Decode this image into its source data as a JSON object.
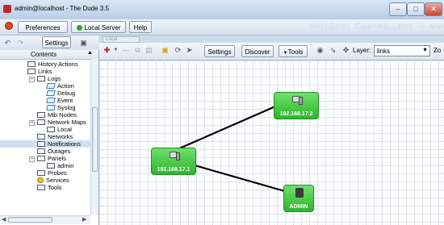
{
  "window": {
    "title": "admin@localhost - The Dude 3.5"
  },
  "toolbar": {
    "preferences": "Preferences",
    "server": "Local Server",
    "help": "Help",
    "brand": "HotSpot Controllers -> www"
  },
  "sidebar_toolbar": {
    "settings": "Settings"
  },
  "sidebar": {
    "header": "Contents",
    "items": [
      {
        "label": "History Actions",
        "icon": "folder-icon"
      },
      {
        "label": "Links",
        "icon": "folder-icon"
      },
      {
        "label": "Logs",
        "icon": "folder-icon"
      },
      {
        "label": "Action",
        "icon": "log-icon"
      },
      {
        "label": "Debug",
        "icon": "log-icon"
      },
      {
        "label": "Event",
        "icon": "log-icon"
      },
      {
        "label": "Syslog",
        "icon": "log-icon"
      },
      {
        "label": "Mib Nodes",
        "icon": "folder-icon"
      },
      {
        "label": "Network Maps",
        "icon": "folder-icon"
      },
      {
        "label": "Local",
        "icon": "map-icon"
      },
      {
        "label": "Networks",
        "icon": "folder-icon"
      },
      {
        "label": "Notifications",
        "icon": "folder-icon"
      },
      {
        "label": "Outages",
        "icon": "folder-icon"
      },
      {
        "label": "Panels",
        "icon": "folder-icon"
      },
      {
        "label": "admin",
        "icon": "panel-icon"
      },
      {
        "label": "Probes",
        "icon": "folder-icon"
      },
      {
        "label": "Services",
        "icon": "service-icon"
      },
      {
        "label": "Tools",
        "icon": "folder-icon"
      }
    ]
  },
  "map": {
    "tab": "Local",
    "toolbar": {
      "settings": "Settings",
      "discover": "Discover",
      "tools": "Tools",
      "layer_label": "Layer:",
      "layer_value": "links",
      "zoom_label": "Zo"
    },
    "devices": [
      {
        "name": "192.168.17.2",
        "type": "pc"
      },
      {
        "name": "192.168.17.1",
        "type": "pc"
      },
      {
        "name": "ADMIN",
        "type": "lock"
      }
    ]
  },
  "colors": {
    "device": "#3cc03a",
    "selected": "#cfe0f5",
    "close": "#c64a35"
  }
}
